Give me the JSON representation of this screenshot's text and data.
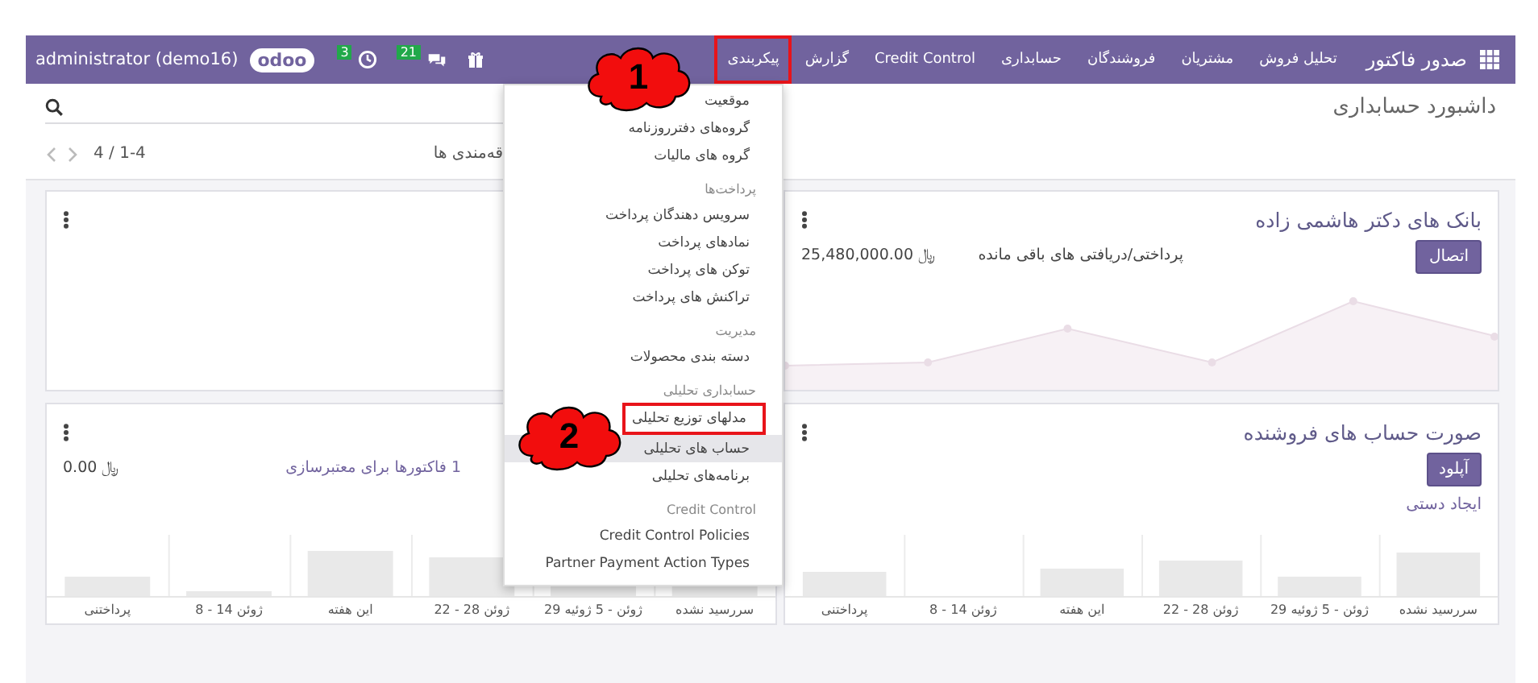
{
  "navbar": {
    "brand": "صدور فاکتور",
    "menu": [
      {
        "label": "تحلیل فروش",
        "selected": false
      },
      {
        "label": "مشتریان",
        "selected": false
      },
      {
        "label": "فروشندگان",
        "selected": false
      },
      {
        "label": "حسابداری",
        "selected": false
      },
      {
        "label": "Credit Control",
        "selected": false
      },
      {
        "label": "گزارش",
        "selected": false
      },
      {
        "label": "پیکربندی",
        "selected": true
      }
    ],
    "user": "administrator (demo16)",
    "logo": "odoo",
    "activity_count": "3",
    "message_count": "21"
  },
  "control_panel": {
    "breadcrumb": "داشبورد حسابداری",
    "filter_label": "قه‌مندی ها",
    "pager": "4 / 1-4"
  },
  "dropdown": [
    {
      "kind": "item",
      "label": "موقعیت",
      "highlighted": false,
      "hovered": false
    },
    {
      "kind": "item",
      "label": "گروه‌های دفترروزنامه",
      "highlighted": false,
      "hovered": false
    },
    {
      "kind": "item",
      "label": "گروه های مالیات",
      "highlighted": false,
      "hovered": false
    },
    {
      "kind": "header",
      "label": "پرداخت‌ها"
    },
    {
      "kind": "item",
      "label": "سرویس دهندگان پرداخت",
      "highlighted": false,
      "hovered": false
    },
    {
      "kind": "item",
      "label": "نمادهای پرداخت",
      "highlighted": false,
      "hovered": false
    },
    {
      "kind": "item",
      "label": "توکن های پرداخت",
      "highlighted": false,
      "hovered": false
    },
    {
      "kind": "item",
      "label": "تراکنش های پرداخت",
      "highlighted": false,
      "hovered": false
    },
    {
      "kind": "header",
      "label": "مدیریت"
    },
    {
      "kind": "item",
      "label": "دسته بندی محصولات",
      "highlighted": false,
      "hovered": false
    },
    {
      "kind": "header",
      "label": "حسابداری تحلیلی"
    },
    {
      "kind": "item",
      "label": "مدلهای توزیع تحلیلی",
      "highlighted": true,
      "hovered": false
    },
    {
      "kind": "item",
      "label": "حساب های تحلیلی",
      "highlighted": false,
      "hovered": true
    },
    {
      "kind": "item",
      "label": "برنامه‌های تحلیلی",
      "highlighted": false,
      "hovered": false
    },
    {
      "kind": "header",
      "label": "Credit Control"
    },
    {
      "kind": "item",
      "label": "Credit Control Policies",
      "highlighted": false,
      "hovered": false
    },
    {
      "kind": "item",
      "label": "Partner Payment Action Types",
      "highlighted": false,
      "hovered": false
    }
  ],
  "cards": [
    {
      "kind": "bank",
      "title": "بانک های دکتر هاشمی زاده",
      "button": "اتصال",
      "summary": "پرداختی/دریافتی های باقی مانده",
      "amount": "25,480,000.00 ﷼"
    },
    {
      "kind": "blank"
    },
    {
      "kind": "bills",
      "title": "صورت حساب های فروشنده",
      "button": "آپلود",
      "secondary_link": "ایجاد دستی",
      "chart_labels": [
        "سررسید نشده",
        "29 ژوئن - 5 ژوئیه",
        "22 - 28 ژوئن",
        "این هفته",
        "8 - 14 ژوئن",
        "پرداختنی"
      ]
    },
    {
      "kind": "bills",
      "summary_link": "1 فاکتورها برای معتبرسازی",
      "amount": "0.00 ﷼",
      "chart_labels": [
        "سررسید نشده",
        "29 ژوئن - 5 ژوئیه",
        "22 - 28 ژوئن",
        "این هفته",
        "8 - 14 ژوئن",
        "پرداختنی"
      ]
    }
  ],
  "callouts": [
    {
      "label": "1"
    },
    {
      "label": "2"
    }
  ]
}
